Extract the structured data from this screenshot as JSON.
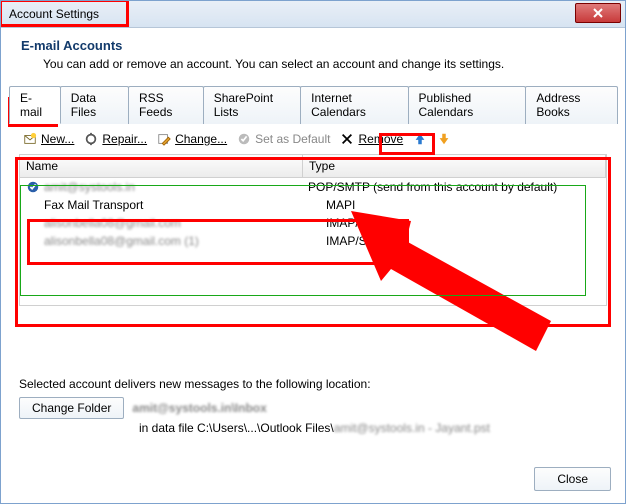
{
  "window": {
    "title": "Account Settings"
  },
  "header": {
    "title": "E-mail Accounts",
    "subtitle": "You can add or remove an account. You can select an account and change its settings."
  },
  "tabs": [
    {
      "label": "E-mail",
      "active": true
    },
    {
      "label": "Data Files"
    },
    {
      "label": "RSS Feeds"
    },
    {
      "label": "SharePoint Lists"
    },
    {
      "label": "Internet Calendars"
    },
    {
      "label": "Published Calendars"
    },
    {
      "label": "Address Books"
    }
  ],
  "toolbar": {
    "new_label": "New...",
    "repair_label": "Repair...",
    "change_label": "Change...",
    "set_default_label": "Set as Default",
    "remove_label": "Remove"
  },
  "list": {
    "headers": {
      "name": "Name",
      "type": "Type"
    },
    "rows": [
      {
        "name": "amit@systools.in",
        "type": "POP/SMTP (send from this account by default)",
        "default": true,
        "blurred": true
      },
      {
        "name": "Fax Mail Transport",
        "type": "MAPI",
        "blurred": false
      },
      {
        "name": "alisonbella08@gmail.com",
        "type": "IMAP/SMTP",
        "blurred": true
      },
      {
        "name": "alisonbella08@gmail.com (1)",
        "type": "IMAP/SMTP",
        "blurred": true
      }
    ]
  },
  "lower": {
    "line1": "Selected account delivers new messages to the following location:",
    "change_folder": "Change Folder",
    "folder": "amit@systools.in\\Inbox",
    "path_prefix": "in data file C:\\Users\\...\\Outlook Files\\",
    "path_blur": "amit@systools.in - Jayant.pst"
  },
  "footer": {
    "close": "Close"
  }
}
